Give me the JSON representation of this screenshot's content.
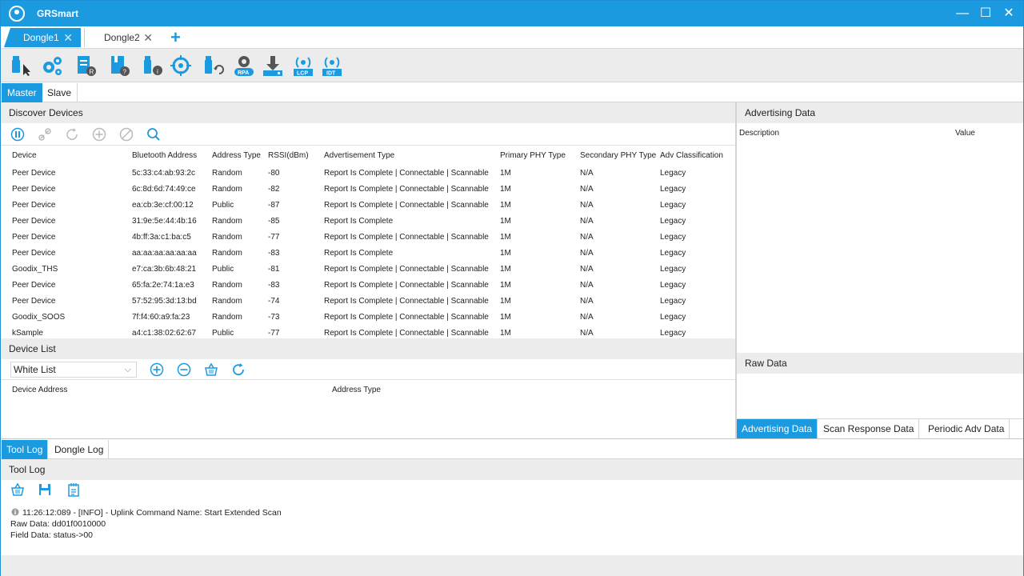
{
  "app": {
    "title": "GRSmart"
  },
  "window_controls": {
    "minimize": "—",
    "maximize": "☐",
    "close": "✕"
  },
  "dongle_tabs": [
    {
      "label": "Dongle1",
      "close": "✕"
    },
    {
      "label": "Dongle2",
      "close": "✕"
    }
  ],
  "add_tab": "+",
  "toolbar": {
    "icons": [
      "usb-select-icon",
      "settings-icon",
      "report-icon",
      "help-book-icon",
      "usb-info-icon",
      "target-icon",
      "usb-refresh-icon",
      "rpa-icon",
      "download-icon",
      "lcp-icon",
      "idt-icon"
    ],
    "rpa_label": "RPA",
    "lcp_label": "LCP",
    "idt_label": "IDT"
  },
  "role_tabs": {
    "master": "Master",
    "slave": "Slave"
  },
  "discover": {
    "title": "Discover Devices",
    "columns": [
      "Device",
      "Bluetooth Address",
      "Address Type",
      "RSSI(dBm)",
      "Advertisement Type",
      "Primary PHY Type",
      "Secondary PHY Type",
      "Adv Classification"
    ],
    "rows": [
      [
        "Peer Device",
        "5c:33:c4:ab:93:2c",
        "Random",
        "-80",
        "Report Is Complete | Connectable | Scannable",
        "1M",
        "N/A",
        "Legacy"
      ],
      [
        "Peer Device",
        "6c:8d:6d:74:49:ce",
        "Random",
        "-82",
        "Report Is Complete | Connectable | Scannable",
        "1M",
        "N/A",
        "Legacy"
      ],
      [
        "Peer Device",
        "ea:cb:3e:cf:00:12",
        "Public",
        "-87",
        "Report Is Complete | Connectable | Scannable",
        "1M",
        "N/A",
        "Legacy"
      ],
      [
        "Peer Device",
        "31:9e:5e:44:4b:16",
        "Random",
        "-85",
        "Report Is Complete",
        "1M",
        "N/A",
        "Legacy"
      ],
      [
        "Peer Device",
        "4b:ff:3a:c1:ba:c5",
        "Random",
        "-77",
        "Report Is Complete | Connectable | Scannable",
        "1M",
        "N/A",
        "Legacy"
      ],
      [
        "Peer Device",
        "aa:aa:aa:aa:aa:aa",
        "Random",
        "-83",
        "Report Is Complete",
        "1M",
        "N/A",
        "Legacy"
      ],
      [
        "Goodix_THS",
        "e7:ca:3b:6b:48:21",
        "Public",
        "-81",
        "Report Is Complete | Connectable | Scannable",
        "1M",
        "N/A",
        "Legacy"
      ],
      [
        "Peer Device",
        "65:fa:2e:74:1a:e3",
        "Random",
        "-83",
        "Report Is Complete | Connectable | Scannable",
        "1M",
        "N/A",
        "Legacy"
      ],
      [
        "Peer Device",
        "57:52:95:3d:13:bd",
        "Random",
        "-74",
        "Report Is Complete | Connectable | Scannable",
        "1M",
        "N/A",
        "Legacy"
      ],
      [
        "Goodix_SOOS",
        "7f:f4:60:a9:fa:23",
        "Random",
        "-73",
        "Report Is Complete | Connectable | Scannable",
        "1M",
        "N/A",
        "Legacy"
      ],
      [
        "kSample",
        "a4:c1:38:02:62:67",
        "Public",
        "-77",
        "Report Is Complete | Connectable | Scannable",
        "1M",
        "N/A",
        "Legacy"
      ]
    ]
  },
  "device_list": {
    "title": "Device List",
    "select_value": "White List",
    "columns": [
      "Device Address",
      "Address Type"
    ]
  },
  "advertising": {
    "title": "Advertising Data",
    "columns": [
      "Description",
      "Value"
    ],
    "raw_title": "Raw Data",
    "tabs": [
      "Advertising Data",
      "Scan Response Data",
      "Periodic Adv Data"
    ]
  },
  "log_tabs": [
    "Tool Log",
    "Dongle Log"
  ],
  "tool_log": {
    "title": "Tool Log",
    "lines": [
      "11:26:12:089 - [INFO] - Uplink Command Name: Start Extended Scan",
      "Raw Data: dd01f0010000",
      "Field Data: status->00"
    ]
  },
  "colors": {
    "accent": "#1c9ae0",
    "header_bg": "#ececec"
  }
}
